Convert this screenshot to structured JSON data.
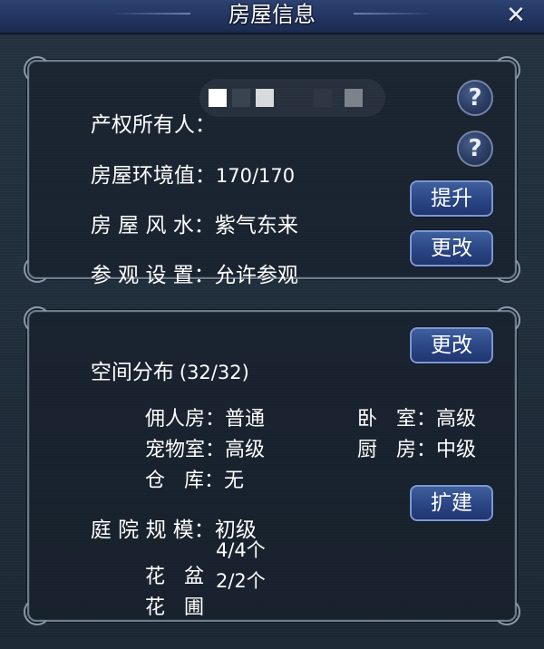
{
  "window": {
    "title": "房屋信息",
    "close_symbol": "✕"
  },
  "house_info": {
    "owner_label": "产权所有人：",
    "environment_label": "房屋环境值：",
    "environment_value": "170/170",
    "fengshui_label": "房 屋 风 水：",
    "fengshui_value": "紫气东来",
    "visit_label": "参 观 设 置：",
    "visit_value": "允许参观",
    "help_symbol": "?",
    "upgrade_button": "提升",
    "change_visit_button": "更改"
  },
  "space": {
    "label": "空间分布",
    "count": "(32/32)",
    "change_button": "更改",
    "rooms": [
      {
        "label": "佣人房：",
        "value": "普通"
      },
      {
        "label": "卧   室：",
        "value": "高级"
      },
      {
        "label": "宠物室：",
        "value": "高级"
      },
      {
        "label": "厨   房：",
        "value": "中级"
      },
      {
        "label": "仓   库：",
        "value": "无"
      }
    ],
    "yard_label": "庭 院 规 模：",
    "yard_value": "初级",
    "expand_button": "扩建",
    "yard_items": [
      {
        "label": "花   盆",
        "value": "4/4个"
      },
      {
        "label": "花   圃",
        "value": "2/2个"
      }
    ]
  }
}
